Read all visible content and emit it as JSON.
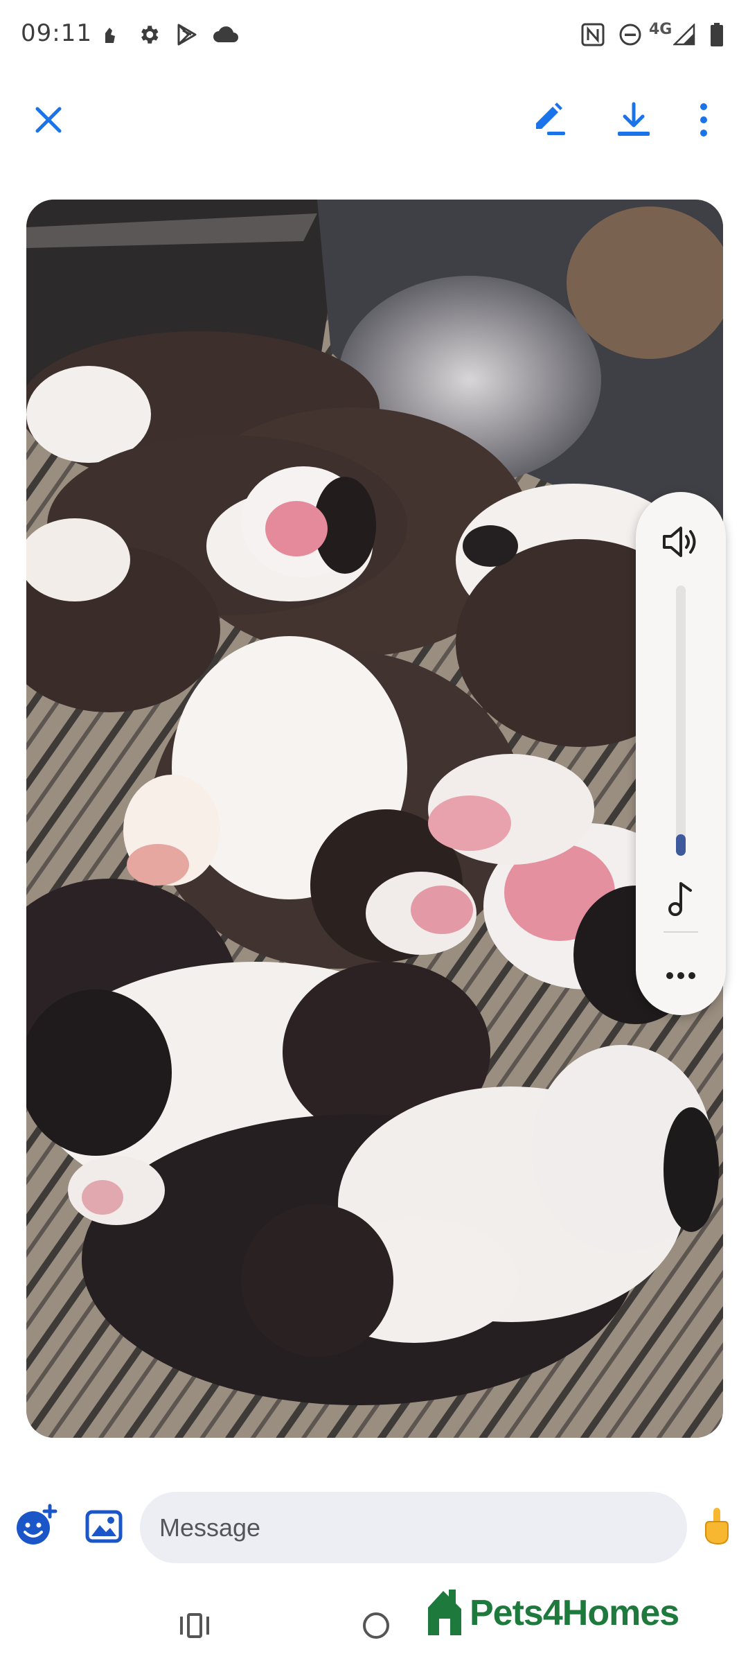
{
  "status_bar": {
    "time": "09:11",
    "network_label": "4G",
    "icons": [
      "notification-icon",
      "gear-icon",
      "play-store-icon",
      "cloud-icon",
      "nfc-icon",
      "dnd-icon",
      "signal-icon",
      "battery-icon"
    ]
  },
  "toolbar": {
    "close_icon": "close-icon",
    "edit_icon": "pencil-edit-icon",
    "download_icon": "download-icon",
    "more_icon": "more-vert-icon",
    "accent_color": "#1a73e8"
  },
  "media": {
    "description_kind": "video",
    "subject": "litter of newborn puppies"
  },
  "volume_panel": {
    "level_fraction": 0.08,
    "icons": [
      "speaker-volume-icon",
      "music-note-icon",
      "more-horiz-icon"
    ]
  },
  "compose": {
    "placeholder": "Message",
    "value": "",
    "icons": [
      "emoji-add-icon",
      "gallery-icon",
      "hand-gesture-icon"
    ]
  },
  "navbar": {
    "icons": [
      "recent-apps-icon",
      "home-icon"
    ]
  },
  "watermark": {
    "text": "Pets4Homes",
    "color": "#1e7a3c"
  }
}
